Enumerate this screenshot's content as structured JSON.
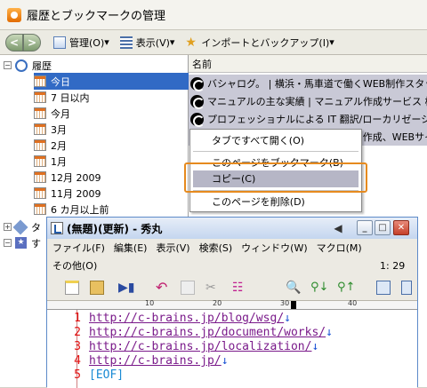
{
  "library": {
    "title": "履歴とブックマークの管理",
    "toolbar": {
      "back": "<",
      "forward": ">",
      "organize": "管理(O)",
      "views": "表示(V)",
      "import_backup": "インポートとバックアップ(I)"
    },
    "tree": {
      "root": "履歴",
      "items": [
        "今日",
        "7 日以内",
        "今月",
        "3月",
        "2月",
        "1月",
        "12月 2009",
        "11月 2009",
        "6 カ月以上前"
      ],
      "partial_1": "タ",
      "partial_2": "す"
    },
    "list": {
      "column_header": "名前",
      "rows": [
        "バシャログ。 | 横浜・馬車道で働くWEB制作スタッフ",
        "マニュアルの主な実績 | マニュアル作成サービス 株",
        "プロフェッショナルによる IT 翻訳/ローカリゼーション",
        "株式会社シーブレイン | マニュアル作成、WEBサイ"
      ]
    },
    "context_menu": {
      "items": [
        "タブですべて開く(O)",
        "このページをブックマーク(B)",
        "コピー(C)",
        "このページを削除(D)"
      ]
    }
  },
  "editor": {
    "title": "(無題)(更新) - 秀丸",
    "menu": [
      "ファイル(F)",
      "編集(E)",
      "表示(V)",
      "検索(S)",
      "ウィンドウ(W)",
      "マクロ(M)"
    ],
    "menu2": "その他(O)",
    "position": "1: 29",
    "ruler_marks": [
      "10",
      "20",
      "30",
      "40"
    ],
    "lines": [
      {
        "num": "1",
        "text": "http://c-brains.jp/blog/wsg/"
      },
      {
        "num": "2",
        "text": "http://c-brains.jp/document/works/"
      },
      {
        "num": "3",
        "text": "http://c-brains.jp/localization/"
      },
      {
        "num": "4",
        "text": "http://c-brains.jp/"
      },
      {
        "num": "5",
        "text": "[EOF]"
      }
    ],
    "newline_mark": "↓"
  },
  "colors": {
    "highlight_orange": "#e68a1e",
    "selection_blue": "#316ac5",
    "line_num_red": "#e01010"
  }
}
